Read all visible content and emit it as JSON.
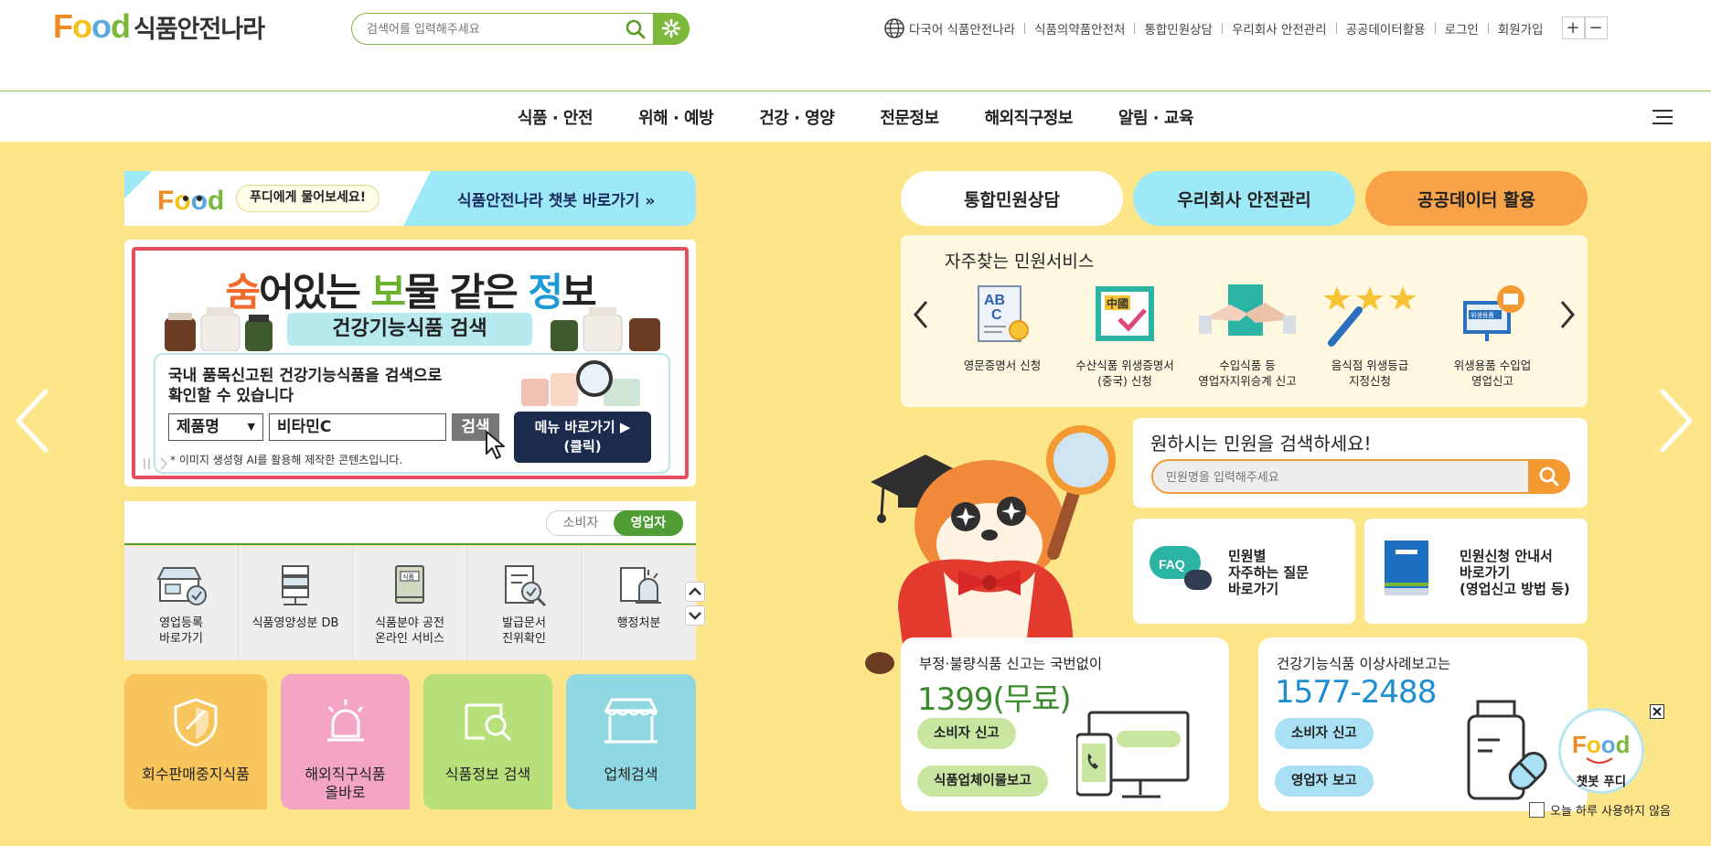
{
  "header": {
    "logo_food": "Food",
    "logo_text": "식품안전나라",
    "search_placeholder": "검색어를 입력해주세요",
    "util_links": [
      "다국어 식품안전나라",
      "식품의약품안전처",
      "통합민원상담",
      "우리회사 안전관리",
      "공공데이터활용",
      "로그인",
      "회원가입"
    ],
    "zoom_in": "+",
    "zoom_out": "−"
  },
  "nav": {
    "items": [
      "식품 · 안전",
      "위해 · 예방",
      "건강 · 영양",
      "전문정보",
      "해외직구정보",
      "알림 · 교육"
    ]
  },
  "chatbot_bar": {
    "ask": "푸디에게 물어보세요!",
    "go": "식품안전나라 챗봇 바로가기 »"
  },
  "banner": {
    "title_parts": [
      "숨",
      "어있는 ",
      "보",
      "물 같은 ",
      "정",
      "보"
    ],
    "heading": "건강기능식품 검색",
    "line1": "국내 품목신고된 건강기능식품을 검색으로",
    "line2": "확인할 수 있습니다",
    "select_value": "제품명",
    "input_value": "비타민C",
    "search_btn": "검색",
    "menu_btn_1": "메뉴 바로가기 ▶",
    "menu_btn_2": "(클릭)",
    "note": "* 이미지 생성형 AI를 활용해 제작한 콘텐츠입니다."
  },
  "user_toggle": {
    "consumer": "소비자",
    "business": "영업자"
  },
  "quick_links": [
    {
      "label": "영업등록\n바로가기",
      "icon": "shop-register-icon"
    },
    {
      "label": "식품영양성분 DB",
      "icon": "server-db-icon"
    },
    {
      "label": "식품분야 공전\n온라인 서비스",
      "icon": "book-icon"
    },
    {
      "label": "발급문서\n진위확인",
      "icon": "document-check-icon"
    },
    {
      "label": "행정처분",
      "icon": "alarm-icon"
    }
  ],
  "tiles": [
    {
      "label": "회수판매중지식품",
      "color": "#f8c45c"
    },
    {
      "label": "해외직구식품\n올바로",
      "color": "#f4a5c4"
    },
    {
      "label": "식품정보 검색",
      "color": "#b8e07a"
    },
    {
      "label": "업체검색",
      "color": "#8fd8e2"
    }
  ],
  "top_buttons": [
    {
      "label": "통합민원상담",
      "color": "#ffffff"
    },
    {
      "label": "우리회사 안전관리",
      "color": "#9ee9f7"
    },
    {
      "label": "공공데이터 활용",
      "color": "#f8a347"
    }
  ],
  "frequent": {
    "title": "자주찾는 민원서비스",
    "items": [
      {
        "label": "영문증명서 신청",
        "icon": "abc-certificate-icon"
      },
      {
        "label": "수산식품 위생증명서\n(중국) 신청",
        "icon": "china-certificate-icon"
      },
      {
        "label": "수입식품 등\n영업자지위승계 신고",
        "icon": "handshake-icon"
      },
      {
        "label": "음식점 위생등급\n지정신청",
        "icon": "stars-icon"
      },
      {
        "label": "위생용품 수입업\n영업신고",
        "icon": "hygiene-monitor-icon"
      }
    ],
    "china_text": "中國",
    "monitor_text": "위생용품"
  },
  "civil_search": {
    "title": "원하시는 민원을 검색하세요!",
    "placeholder": "민원명을 입력해주세요"
  },
  "faq_card": {
    "badge": "FAQ",
    "label": "민원별\n자주하는 질문\n바로가기"
  },
  "guide_card": {
    "label": "민원신청 안내서\n바로가기\n(영업신고 방법 등)"
  },
  "hotline1": {
    "title": "부정·불량식품 신고는 국번없이",
    "number": "1399(무료)",
    "btn1": "소비자 신고",
    "btn2": "식품업체이물보고",
    "color": "#3b8a2e"
  },
  "hotline2": {
    "title": "건강기능식품 이상사례보고는",
    "number": "1577-2488",
    "btn1": "소비자 신고",
    "btn2": "영업자 보고",
    "color": "#1d8fd1"
  },
  "floating": {
    "chatbot_label": "챗봇 푸디",
    "not_today": "오늘 하루 사용하지 않음"
  },
  "colors": {
    "brand_green": "#7cb93a",
    "page_bg": "#fde68a",
    "accent_orange": "#f39a33"
  }
}
